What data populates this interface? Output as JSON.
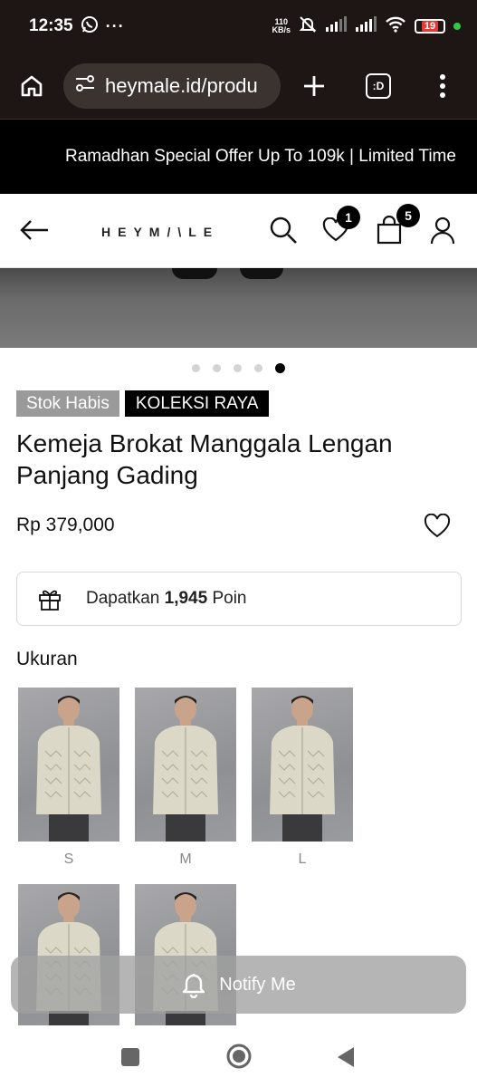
{
  "status_bar": {
    "time": "12:35",
    "network_speed_value": "110",
    "network_speed_unit": "KB/s",
    "battery": "19",
    "icons": [
      "whatsapp-icon",
      "more-icon",
      "mute-icon",
      "signal-icon",
      "signal-icon",
      "wifi-icon",
      "battery-icon"
    ]
  },
  "browser": {
    "url": "heymale.id/produ",
    "tab_label": ":D"
  },
  "promo": {
    "text": "Ramadhan Special Offer Up To 109k | Limited Time"
  },
  "site_header": {
    "logo": "HEYM/\\LE",
    "wishlist_count": "1",
    "cart_count": "5"
  },
  "carousel": {
    "total": 5,
    "active_index": 4
  },
  "product": {
    "tags": [
      "Stok Habis",
      "KOLEKSI RAYA"
    ],
    "title": "Kemeja Brokat Manggala Lengan Panjang Gading",
    "price": "Rp 379,000",
    "points_prefix": "Dapatkan",
    "points_value": "1,945",
    "points_suffix": "Poin"
  },
  "sizes": {
    "title": "Ukuran",
    "options": [
      "S",
      "M",
      "L",
      "",
      ""
    ]
  },
  "notify": {
    "label": "Notify Me"
  },
  "colors": {
    "status_bg": "#1d1614",
    "accent": "#000000",
    "battery_low": "#e53935"
  }
}
